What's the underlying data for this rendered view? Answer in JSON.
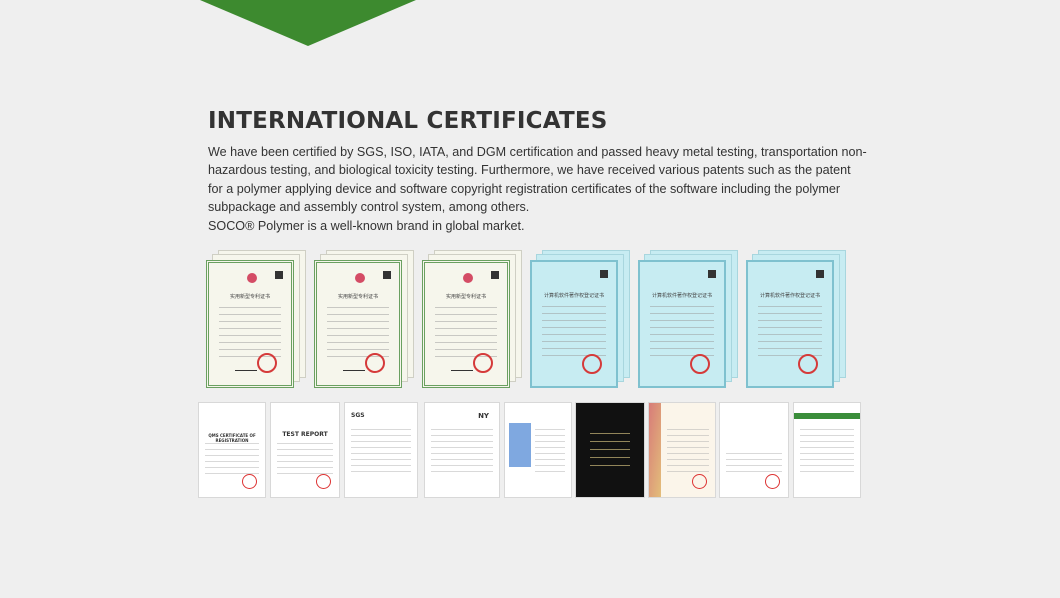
{
  "section": {
    "title": "INTERNATIONAL CERTIFICATES",
    "paragraphs": [
      "We have been certified by SGS, ISO, IATA, and DGM certification and passed heavy metal testing, transportation non-hazardous testing, and biological toxicity testing. Furthermore, we have received various patents such as the patent for a polymer applying device and software copyright registration certificates of the software including the polymer subpackage and assembly control system, among others.",
      "SOCO® Polymer is a well-known brand in global market."
    ]
  },
  "certificates": {
    "patents": [
      {
        "heading": "实用新型专利证书"
      },
      {
        "heading": "实用新型专利证书"
      },
      {
        "heading": "实用新型专利证书"
      }
    ],
    "software": [
      {
        "heading": "计算机软件著作权登记证书"
      },
      {
        "heading": "计算机软件著作权登记证书"
      },
      {
        "heading": "计算机软件著作权登记证书"
      }
    ],
    "documents": [
      {
        "heading": "QMS CERTIFICATE OF REGISTRATION"
      },
      {
        "heading": "TEST REPORT"
      },
      {
        "heading": "SGS"
      },
      {
        "heading": "NY"
      },
      {
        "heading": ""
      },
      {
        "heading": ""
      },
      {
        "heading": ""
      },
      {
        "heading": ""
      },
      {
        "heading": ""
      }
    ]
  },
  "colors": {
    "accent": "#3d8a2f",
    "background": "#efefef",
    "text": "#333333"
  }
}
